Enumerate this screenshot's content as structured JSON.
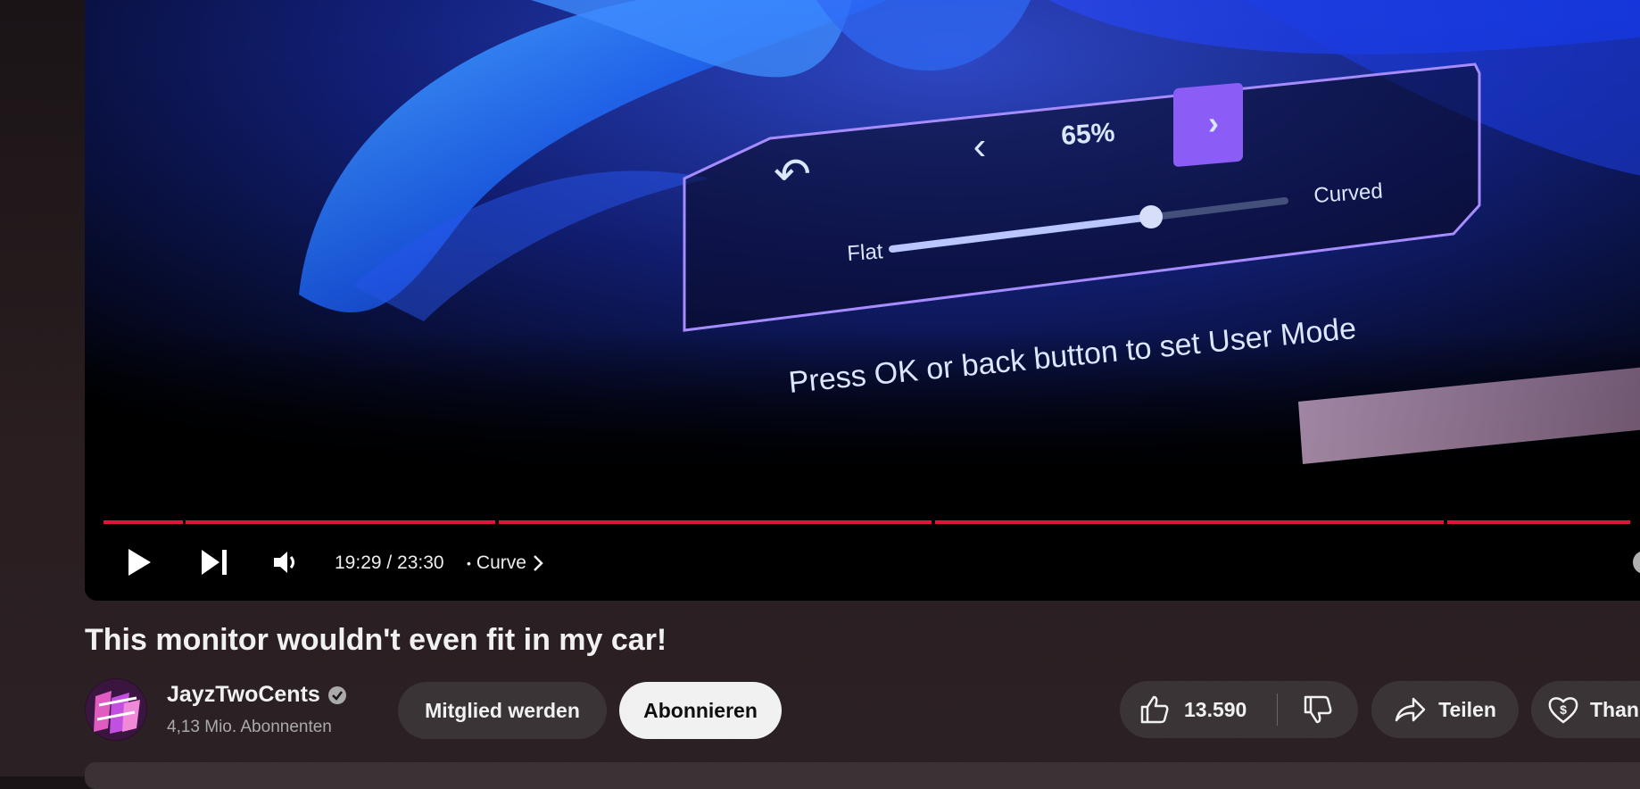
{
  "video": {
    "osd": {
      "value": "65%",
      "left_label": "Flat",
      "right_label": "Curved",
      "message": "Press OK or back button to set User Mode",
      "slider_value": 0.65
    },
    "progress": 0.829,
    "current_time": "19:29",
    "duration": "23:30",
    "time_display": "19:29 / 23:30",
    "chapter_separator": "•",
    "chapter": "Curve",
    "icons": {
      "play": "play-icon",
      "next": "next-icon",
      "volume": "volume-icon",
      "chapter": "chevron-right-icon"
    }
  },
  "title": "This monitor wouldn't even fit in my car!",
  "channel": {
    "name": "JayzTwoCents",
    "verified_icon": "verified-check-icon",
    "subscribers": "4,13 Mio. Abonnenten"
  },
  "actions": {
    "join": "Mitglied werden",
    "subscribe": "Abonnieren",
    "likes": "13.590",
    "share": "Teilen",
    "thanks": "Than"
  },
  "colors": {
    "accent_red": "#e1143c",
    "osd_purple": "#8b5cf6",
    "pill_dark": "#3b3436"
  }
}
